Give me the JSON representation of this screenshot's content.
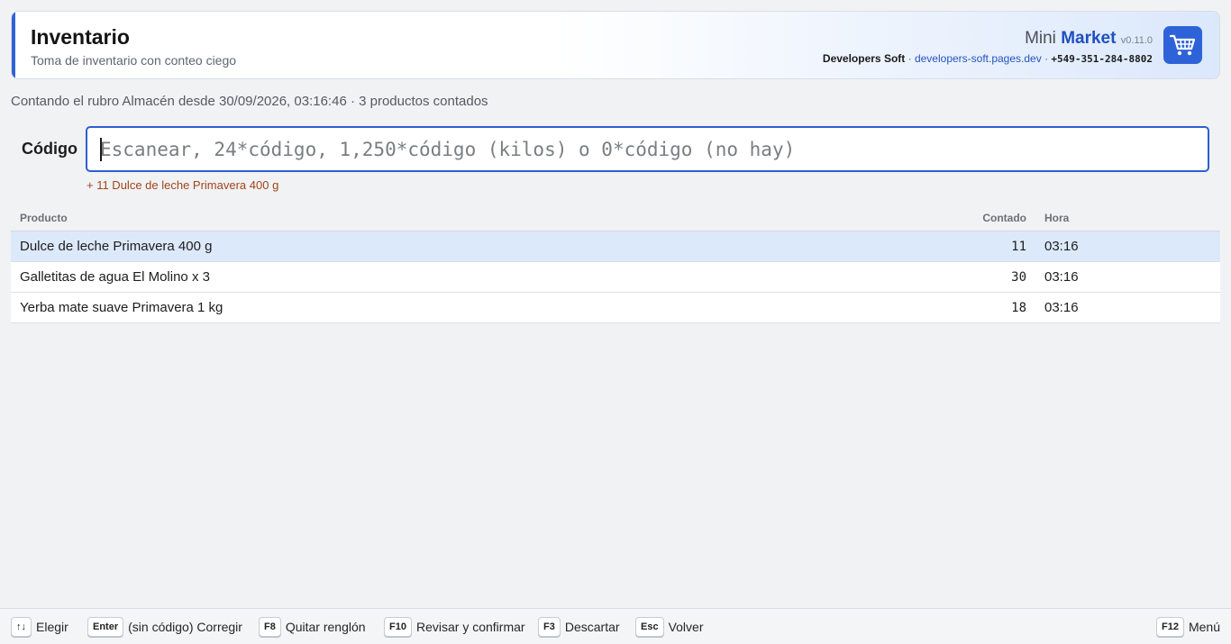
{
  "header": {
    "title": "Inventario",
    "subtitle": "Toma de inventario con conteo ciego",
    "brand_mini": "Mini",
    "brand_market": "Market",
    "version": "v0.11.0",
    "company": "Developers Soft",
    "separator": "·",
    "website": "developers-soft.pages.dev",
    "phone": "+549-351-284-8802",
    "cart_icon": "shopping-cart-icon",
    "accent_color": "#2f62d6"
  },
  "status": "Contando el rubro Almacén desde 30/09/2026, 03:16:46 · 3 productos contados",
  "code": {
    "label": "Código",
    "value": "",
    "placeholder": "Escanear, 24*código, 1,250*código (kilos) o 0*código (no hay)",
    "feedback": "+ 11 Dulce de leche Primavera 400 g"
  },
  "table": {
    "headers": {
      "producto": "Producto",
      "contado": "Contado",
      "hora": "Hora"
    },
    "rows": [
      {
        "producto": "Dulce de leche Primavera 400 g",
        "contado": "11",
        "hora": "03:16",
        "selected": true
      },
      {
        "producto": "Galletitas de agua El Molino x 3",
        "contado": "30",
        "hora": "03:16",
        "selected": false
      },
      {
        "producto": "Yerba mate suave Primavera 1 kg",
        "contado": "18",
        "hora": "03:16",
        "selected": false
      }
    ]
  },
  "footer": {
    "shortcuts": [
      {
        "key": "↑↓",
        "label": "Elegir"
      },
      {
        "key": "Enter",
        "label": "(sin código) Corregir"
      },
      {
        "key": "F8",
        "label": "Quitar renglón"
      },
      {
        "key": "F10",
        "label": "Revisar y confirmar"
      },
      {
        "key": "F3",
        "label": "Descartar"
      },
      {
        "key": "Esc",
        "label": "Volver"
      },
      {
        "key": "F12",
        "label": "Menú"
      }
    ]
  }
}
